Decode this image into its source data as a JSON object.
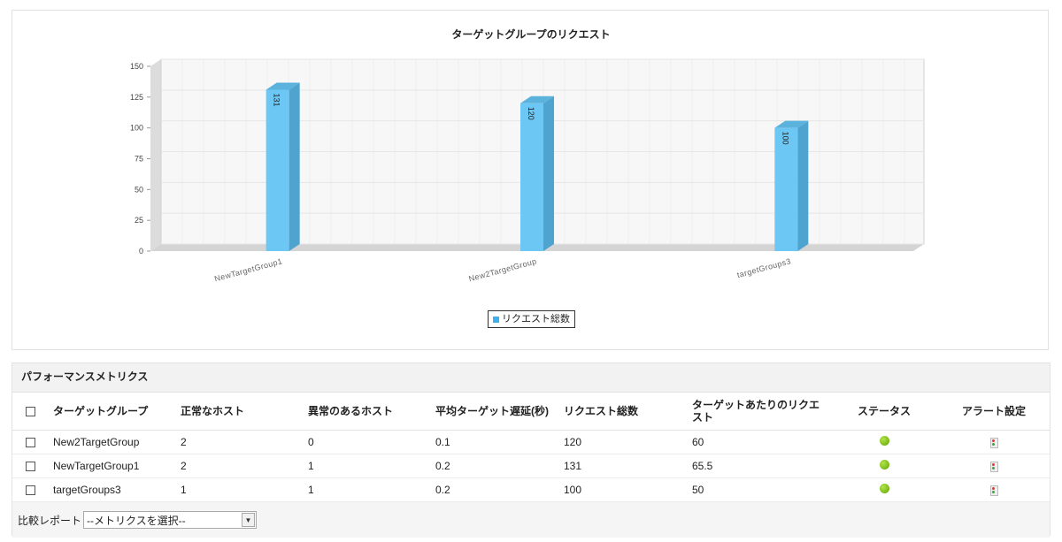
{
  "chart_data": {
    "type": "bar",
    "title": "ターゲットグループのリクエスト",
    "categories": [
      "NewTargetGroup1",
      "New2TargetGroup",
      "targetGroups3"
    ],
    "series": [
      {
        "name": "リクエスト総数",
        "values": [
          131,
          120,
          100
        ]
      }
    ],
    "ylim": [
      0,
      150
    ],
    "yticks": [
      0,
      25,
      50,
      75,
      100,
      125,
      150
    ],
    "xlabel": "",
    "ylabel": "",
    "grid": true,
    "legend": "bottom-center",
    "bar_color": "#6cc7f5"
  },
  "metrics": {
    "title": "パフォーマンスメトリクス",
    "columns": [
      "ターゲットグループ",
      "正常なホスト",
      "異常のあるホスト",
      "平均ターゲット遅延(秒)",
      "リクエスト総数",
      "ターゲットあたりのリクエスト",
      "ステータス",
      "アラート設定"
    ],
    "rows": [
      {
        "group": "New2TargetGroup",
        "healthy": "2",
        "unhealthy": "0",
        "latency": "0.1",
        "requests": "120",
        "per_target": "60"
      },
      {
        "group": "NewTargetGroup1",
        "healthy": "2",
        "unhealthy": "1",
        "latency": "0.2",
        "requests": "131",
        "per_target": "65.5"
      },
      {
        "group": "targetGroups3",
        "healthy": "1",
        "unhealthy": "1",
        "latency": "0.2",
        "requests": "100",
        "per_target": "50"
      }
    ],
    "status_icon": "green-status-dot",
    "alert_icon": "traffic-light-icon"
  },
  "footer": {
    "compare_label": "比較レポート",
    "select_value": "--メトリクスを選択--"
  },
  "colors": {
    "status_ok": "#7fbf1d",
    "legend_swatch": "#3fb0ee"
  }
}
